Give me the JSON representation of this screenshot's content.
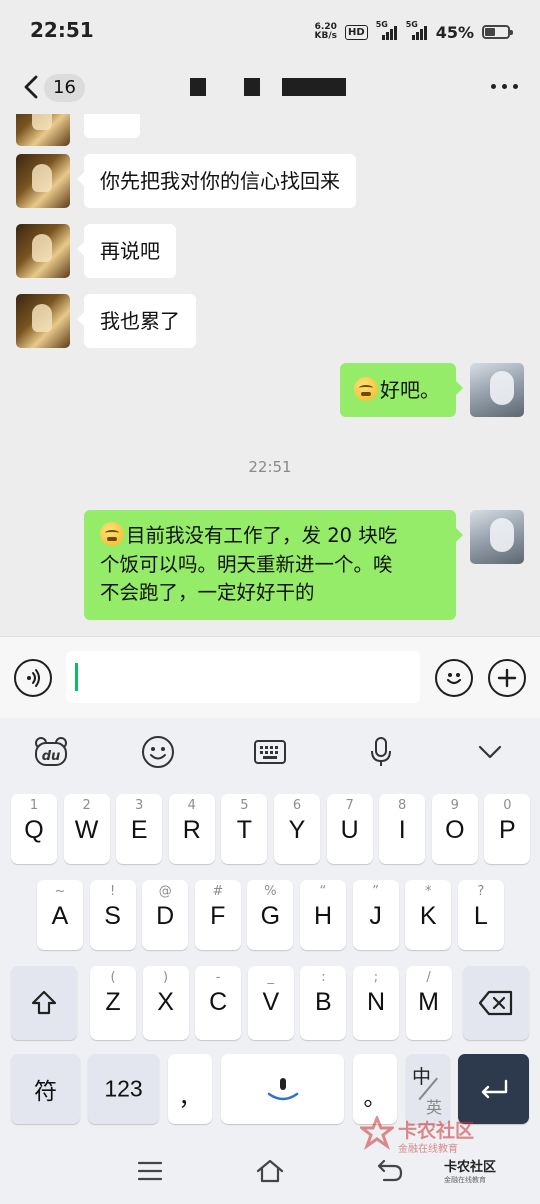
{
  "status_bar": {
    "time": "22:51",
    "net_speed_top": "6.20",
    "net_speed_bottom": "KB/s",
    "hd_label": "HD",
    "sim1_label": "5G",
    "sim2_label": "5G",
    "battery_percent": "45%",
    "battery_level": 0.45
  },
  "nav": {
    "unread_count": "16",
    "title": "",
    "back_icon": "chevron-left-icon",
    "more_icon": "ellipsis-icon"
  },
  "messages": [
    {
      "side": "in",
      "text": "你先把我对你的信心找回来"
    },
    {
      "side": "in",
      "text": "再说吧"
    },
    {
      "side": "in",
      "text": "我也累了"
    },
    {
      "side": "out",
      "emoji": "pensive-face",
      "text": "好吧。"
    },
    {
      "timestamp": "22:51"
    },
    {
      "side": "out",
      "emoji": "pensive-face",
      "line1": "目前我没有工作了，发 20 块吃",
      "line2": "个饭可以吗。明天重新进一个。唉",
      "line3": "不会跑了，一定好好干的"
    }
  ],
  "input": {
    "value": "",
    "voice_icon": "voice-icon",
    "emoji_icon": "smile-icon",
    "plus_icon": "plus-icon"
  },
  "keyboard": {
    "toolbar_icons": [
      "du-bear-icon",
      "emoji-face-icon",
      "keyboard-icon",
      "microphone-icon",
      "chevron-down-icon"
    ],
    "row1": [
      {
        "hint": "1",
        "key": "Q"
      },
      {
        "hint": "2",
        "key": "W"
      },
      {
        "hint": "3",
        "key": "E"
      },
      {
        "hint": "4",
        "key": "R"
      },
      {
        "hint": "5",
        "key": "T"
      },
      {
        "hint": "6",
        "key": "Y"
      },
      {
        "hint": "7",
        "key": "U"
      },
      {
        "hint": "8",
        "key": "I"
      },
      {
        "hint": "9",
        "key": "O"
      },
      {
        "hint": "0",
        "key": "P"
      }
    ],
    "row2": [
      {
        "hint": "~",
        "key": "A"
      },
      {
        "hint": "!",
        "key": "S"
      },
      {
        "hint": "@",
        "key": "D"
      },
      {
        "hint": "#",
        "key": "F"
      },
      {
        "hint": "%",
        "key": "G"
      },
      {
        "hint": "“",
        "key": "H"
      },
      {
        "hint": "”",
        "key": "J"
      },
      {
        "hint": "*",
        "key": "K"
      },
      {
        "hint": "?",
        "key": "L"
      }
    ],
    "row3": [
      {
        "hint": "(",
        "key": "Z"
      },
      {
        "hint": ")",
        "key": "X"
      },
      {
        "hint": "-",
        "key": "C"
      },
      {
        "hint": "_",
        "key": "V"
      },
      {
        "hint": ":",
        "key": "B"
      },
      {
        "hint": ";",
        "key": "N"
      },
      {
        "hint": "/",
        "key": "M"
      }
    ],
    "symbol_key": "符",
    "number_key": "123",
    "comma_key": "，",
    "period_key": "。",
    "lang_primary": "中",
    "lang_secondary": "英"
  },
  "watermark": {
    "name": "卡农社区",
    "subtitle": "金融在线教育",
    "name2": "卡农社区"
  }
}
